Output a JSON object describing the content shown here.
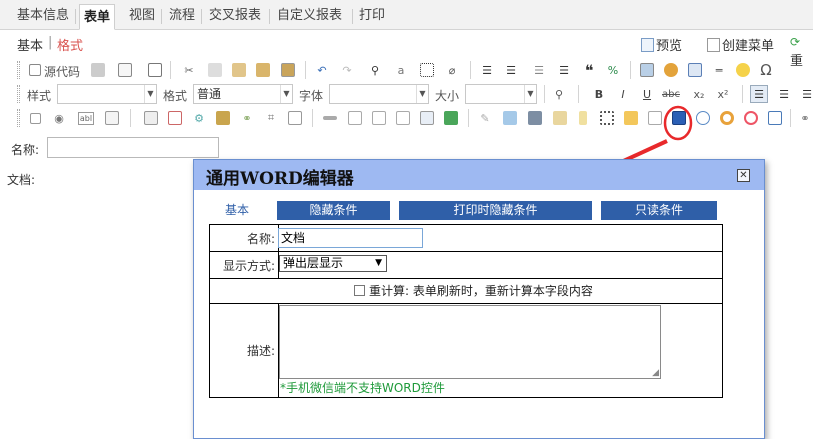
{
  "tabs": [
    "基本信息",
    "表单",
    "视图",
    "流程",
    "交叉报表",
    "自定义报表",
    "打印"
  ],
  "subheader": {
    "basic": "基本",
    "separator": "|",
    "format": "格式",
    "preview": "预览",
    "create_menu": "创建菜单",
    "cut_off": "重"
  },
  "toolbar": {
    "source": "源代码",
    "style_label": "样式",
    "format_label": "格式",
    "format_value": "普通",
    "font_label": "字体",
    "size_label": "大小",
    "bold": "B",
    "italic": "I",
    "underline": "U",
    "strike": "abc",
    "subscript": "x₂",
    "superscript": "x²",
    "quote": "❝",
    "omega": "Ω"
  },
  "form": {
    "name_label": "名称:",
    "doc_label": "文档:"
  },
  "dialog": {
    "title": "通用WORD编辑器",
    "close": "✕",
    "tabs": [
      "基本",
      "隐藏条件",
      "打印时隐藏条件",
      "只读条件"
    ],
    "name_label": "名称:",
    "name_value": "文档",
    "display_label": "显示方式:",
    "display_value": "弹出层显示",
    "recalc_label": "重计算:",
    "recalc_desc": "表单刷新时，重新计算本字段内容",
    "desc_label": "描述:",
    "note": "*手机微信端不支持WORD控件"
  },
  "colors": {
    "dialog_title_bg": "#9eb9f2",
    "tab_blue": "#2f5fa8",
    "annotation_red": "#e8292b",
    "note_green": "#1f9a3a"
  }
}
